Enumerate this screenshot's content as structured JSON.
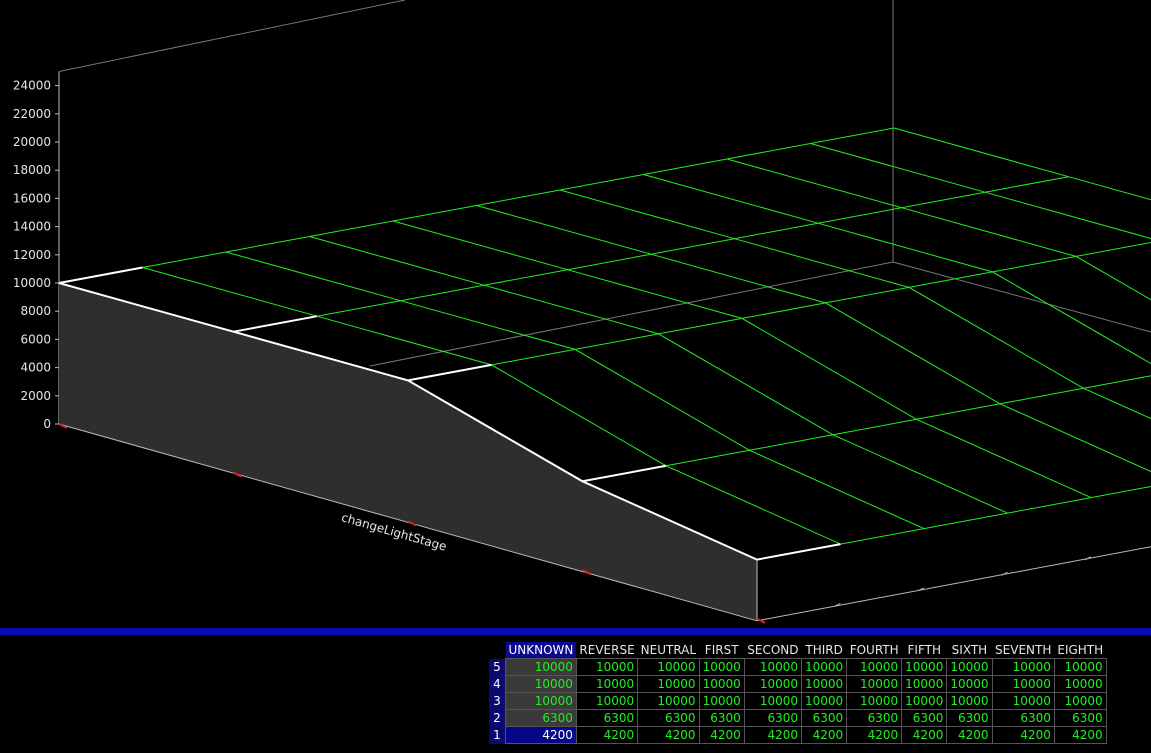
{
  "chart_data": {
    "type": "surface3d",
    "axis_label": "changeLightStage",
    "z_ticks": [
      "0",
      "2000",
      "4000",
      "6000",
      "8000",
      "10000",
      "12000",
      "14000",
      "16000",
      "18000",
      "20000",
      "22000",
      "24000"
    ],
    "z_range": [
      0,
      24000
    ],
    "rows": [
      "5",
      "4",
      "3",
      "2",
      "1"
    ],
    "columns": [
      "UNKNOWN",
      "REVERSE",
      "NEUTRAL",
      "FIRST",
      "SECOND",
      "THIRD",
      "FOURTH",
      "FIFTH",
      "SIXTH",
      "SEVENTH",
      "EIGHTH"
    ],
    "values": [
      [
        "10000",
        "10000",
        "10000",
        "10000",
        "10000",
        "10000",
        "10000",
        "10000",
        "10000",
        "10000",
        "10000"
      ],
      [
        "10000",
        "10000",
        "10000",
        "10000",
        "10000",
        "10000",
        "10000",
        "10000",
        "10000",
        "10000",
        "10000"
      ],
      [
        "10000",
        "10000",
        "10000",
        "10000",
        "10000",
        "10000",
        "10000",
        "10000",
        "10000",
        "10000",
        "10000"
      ],
      [
        "6300",
        "6300",
        "6300",
        "6300",
        "6300",
        "6300",
        "6300",
        "6300",
        "6300",
        "6300",
        "6300"
      ],
      [
        "4200",
        "4200",
        "4200",
        "4200",
        "4200",
        "4200",
        "4200",
        "4200",
        "4200",
        "4200",
        "4200"
      ]
    ],
    "selected_column": "UNKNOWN",
    "selected_row": "1",
    "colors": {
      "grid": "#22ee22",
      "edge": "#ffffff",
      "wall": "#2e2e2e",
      "axis": "#bbbbbb",
      "tick_mark": "#dd2222",
      "divider": "#0a0ab0"
    }
  }
}
